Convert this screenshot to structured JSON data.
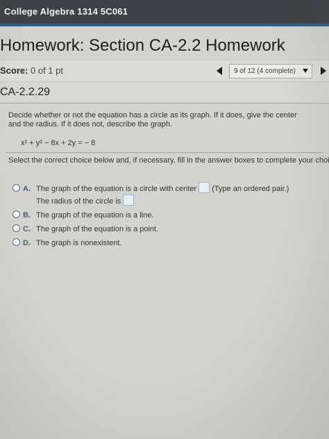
{
  "course": {
    "title": "College Algebra 1314 5C061"
  },
  "homework": {
    "title": "Homework: Section CA-2.2 Homework"
  },
  "score": {
    "label": "Score:",
    "value": "0 of 1 pt"
  },
  "navigation": {
    "progress": "9 of 12 (4 complete)"
  },
  "question": {
    "id": "CA-2.2.29",
    "prompt_line1": "Decide whether or not the equation has a circle as its graph. If it does, give the center",
    "prompt_line2": "and the radius. If it does not, describe the graph.",
    "equation": "x² + y² − 8x + 2y = − 8",
    "instruction": "Select the correct choice below and, if necessary, fill in the answer boxes to complete your choice."
  },
  "choices": [
    {
      "letter": "A.",
      "text": "The graph of the equation is a circle with center",
      "hint": "(Type an ordered pair.)",
      "subtext": "The radius of the circle is"
    },
    {
      "letter": "B.",
      "text": "The graph of the equation is a line."
    },
    {
      "letter": "C.",
      "text": "The graph of the equation is a point."
    },
    {
      "letter": "D.",
      "text": "The graph is nonexistent."
    }
  ]
}
